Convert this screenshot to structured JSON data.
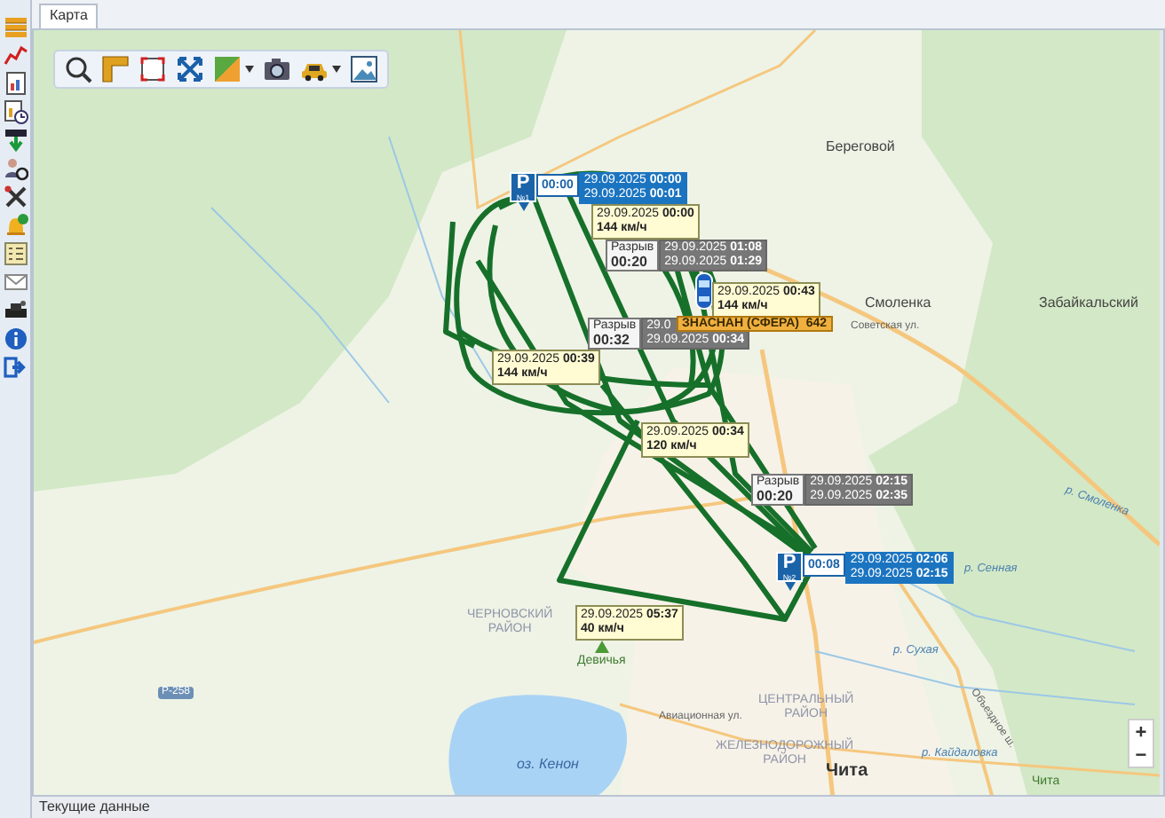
{
  "tab": {
    "label": "Карта",
    "selected": true
  },
  "map": {
    "places": [
      {
        "text": "Береговой",
        "kind": "settlement"
      },
      {
        "text": "Смоленка",
        "kind": "settlement"
      },
      {
        "text": "Забайкальский",
        "kind": "settlement"
      },
      {
        "text": "Советская ул.",
        "kind": "street"
      },
      {
        "text": "р. Смоленка",
        "kind": "river"
      },
      {
        "text": "р. Сенная",
        "kind": "river"
      },
      {
        "text": "р. Сухая",
        "kind": "river"
      },
      {
        "text": "ЦЕНТРАЛЬНЫЙ РАЙОН",
        "kind": "district"
      },
      {
        "text": "Чита",
        "kind": "city"
      },
      {
        "text": "р. Кайдаловка",
        "kind": "river"
      },
      {
        "text": "Чита",
        "kind": "park"
      },
      {
        "text": "ЧЕРНОВСКИЙ РАЙОН",
        "kind": "district"
      },
      {
        "text": "Девичья",
        "kind": "park"
      },
      {
        "text": "оз. Кенон",
        "kind": "lake"
      },
      {
        "text": "Авиационная ул.",
        "kind": "street"
      },
      {
        "text": "ЖЕЛЕЗНОДОРОЖНЫЙ РАЙОН",
        "kind": "district"
      },
      {
        "text": "Объездное ш.",
        "kind": "street"
      },
      {
        "text": "Р-258",
        "kind": "road_number"
      }
    ],
    "callouts": [
      {
        "kind": "parking",
        "letter": "P",
        "number": "№1",
        "duration": "00:00",
        "lines": [
          "29.09.2025 **00:00**",
          "29.09.2025 **00:01**"
        ]
      },
      {
        "kind": "speed",
        "lines": [
          "29.09.2025 **00:00**",
          "144 км/ч"
        ]
      },
      {
        "kind": "gap",
        "title": "Разрыв",
        "duration": "00:20",
        "lines": [
          "29.09.2025 **01:08**",
          "29.09.2025 **01:29**"
        ]
      },
      {
        "kind": "speed",
        "lines": [
          "29.09.2025 **00:43**",
          "144 км/ч"
        ]
      },
      {
        "kind": "gap",
        "title": "Разрыв",
        "duration": "00:32",
        "lines": [
          "29.0",
          "29.09.2025 **00:34**"
        ]
      },
      {
        "kind": "vehicle_name",
        "text": "ЗНАСНАН (СФЕРА)  642"
      },
      {
        "kind": "speed",
        "lines": [
          "29.09.2025 **00:39**",
          "144 км/ч"
        ]
      },
      {
        "kind": "speed",
        "lines": [
          "29.09.2025 **00:34**",
          "120 км/ч"
        ]
      },
      {
        "kind": "gap",
        "title": "Разрыв",
        "duration": "00:20",
        "lines": [
          "29.09.2025 **02:15**",
          "29.09.2025 **02:35**"
        ]
      },
      {
        "kind": "parking",
        "letter": "P",
        "number": "№2",
        "duration": "00:08",
        "lines": [
          "29.09.2025 **02:06**",
          "29.09.2025 **02:15**"
        ]
      },
      {
        "kind": "speed",
        "lines": [
          "29.09.2025 **05:37**",
          "40 км/ч"
        ]
      }
    ],
    "zoom_buttons": [
      "+",
      "−"
    ]
  },
  "status_bar": "Текущие данные"
}
